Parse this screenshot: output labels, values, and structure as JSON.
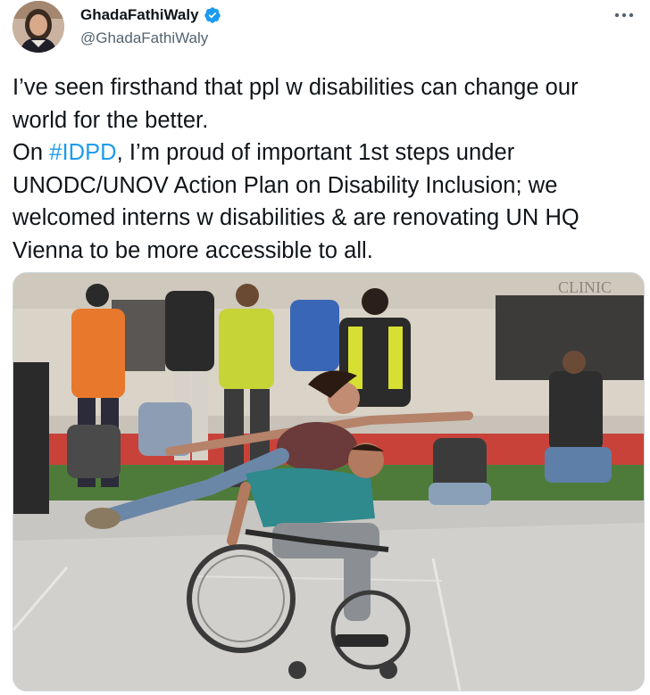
{
  "author": {
    "display_name": "GhadaFathiWaly",
    "handle": "@GhadaFathiWaly",
    "verified": true,
    "avatar_icon": "profile-photo"
  },
  "tweet": {
    "line1": "I’ve seen firsthand that ppl w disabilities can change our world for the better.",
    "line2_before": "On ",
    "hashtag": "#IDPD",
    "line2_after": ", I’m proud of important 1st steps under UNODC/UNOV Action Plan on Disability Inclusion; we welcomed interns w disabilities & are renovating UN HQ Vienna to be more accessible to all."
  },
  "media": {
    "building_sign": "CLINIC",
    "description_icon": "photo-dancers-wheelchair"
  },
  "colors": {
    "accent": "#1d9bf0",
    "text": "#0f1419",
    "secondary": "#536471",
    "border": "#cfd9de"
  },
  "icons": {
    "more": "more-options-icon",
    "verified": "verified-badge-icon"
  }
}
